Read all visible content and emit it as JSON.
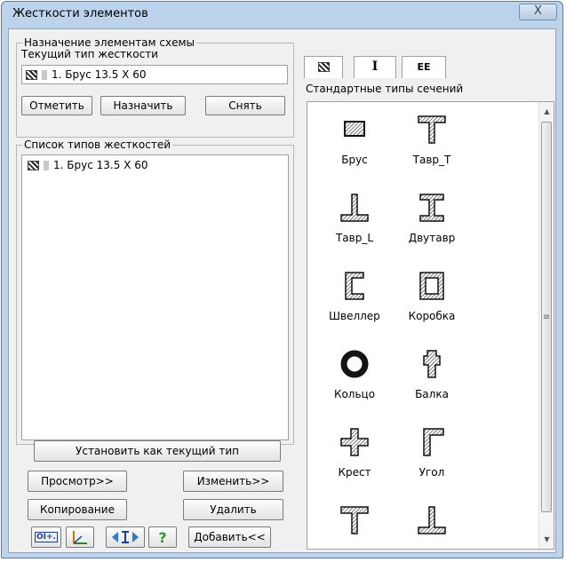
{
  "window": {
    "title": "Жесткости элементов",
    "close_glyph": "X"
  },
  "assign_group": {
    "legend": "Назначение элементам схемы",
    "current_type_label": "Текущий тип жесткости",
    "current_type_value": "1. Брус 13.5 X 60",
    "buttons": {
      "mark": "Отметить",
      "assign": "Назначить",
      "remove": "Снять"
    }
  },
  "types_group": {
    "legend": "Список типов жесткостей",
    "items": [
      {
        "label": "1. Брус 13.5 X 60"
      }
    ]
  },
  "actions": {
    "set_current": "Установить как текущий тип",
    "view": "Просмотр>>",
    "edit": "Изменить>>",
    "copy": "Копирование",
    "delete": "Удалить",
    "add": "Добавить<<"
  },
  "tabs": [
    {
      "icon": "hatched-square-icon"
    },
    {
      "icon": "i-beam-icon",
      "label": "I"
    },
    {
      "icon": "double-section-icon",
      "label": "EE"
    }
  ],
  "sections_caption": "Стандартные типы сечений",
  "sections": [
    {
      "icon": "brus-icon",
      "label": "Брус"
    },
    {
      "icon": "tavr-t-icon",
      "label": "Тавр_T"
    },
    {
      "icon": "tavr-l-icon",
      "label": "Тавр_L"
    },
    {
      "icon": "dvutavr-icon",
      "label": "Двутавр"
    },
    {
      "icon": "shveller-icon",
      "label": "Швеллер"
    },
    {
      "icon": "korobka-icon",
      "label": "Коробка"
    },
    {
      "icon": "koltso-icon",
      "label": "Кольцо"
    },
    {
      "icon": "balka-icon",
      "label": "Балка"
    },
    {
      "icon": "krest-icon",
      "label": "Крест"
    },
    {
      "icon": "ugol-icon",
      "label": "Угол"
    },
    {
      "icon": "tavr-t-icon",
      "label": ""
    },
    {
      "icon": "tavr-l-icon",
      "label": ""
    }
  ],
  "toolbar": {
    "icons": [
      "params-icon",
      "axes-icon",
      "swap-icon",
      "help-icon"
    ],
    "help_glyph": "?",
    "params_glyph": "ΟΙ+."
  },
  "colors": {
    "frame": "#bcd3ec",
    "client": "#f0f0f0",
    "help": "#2a9a2a"
  }
}
